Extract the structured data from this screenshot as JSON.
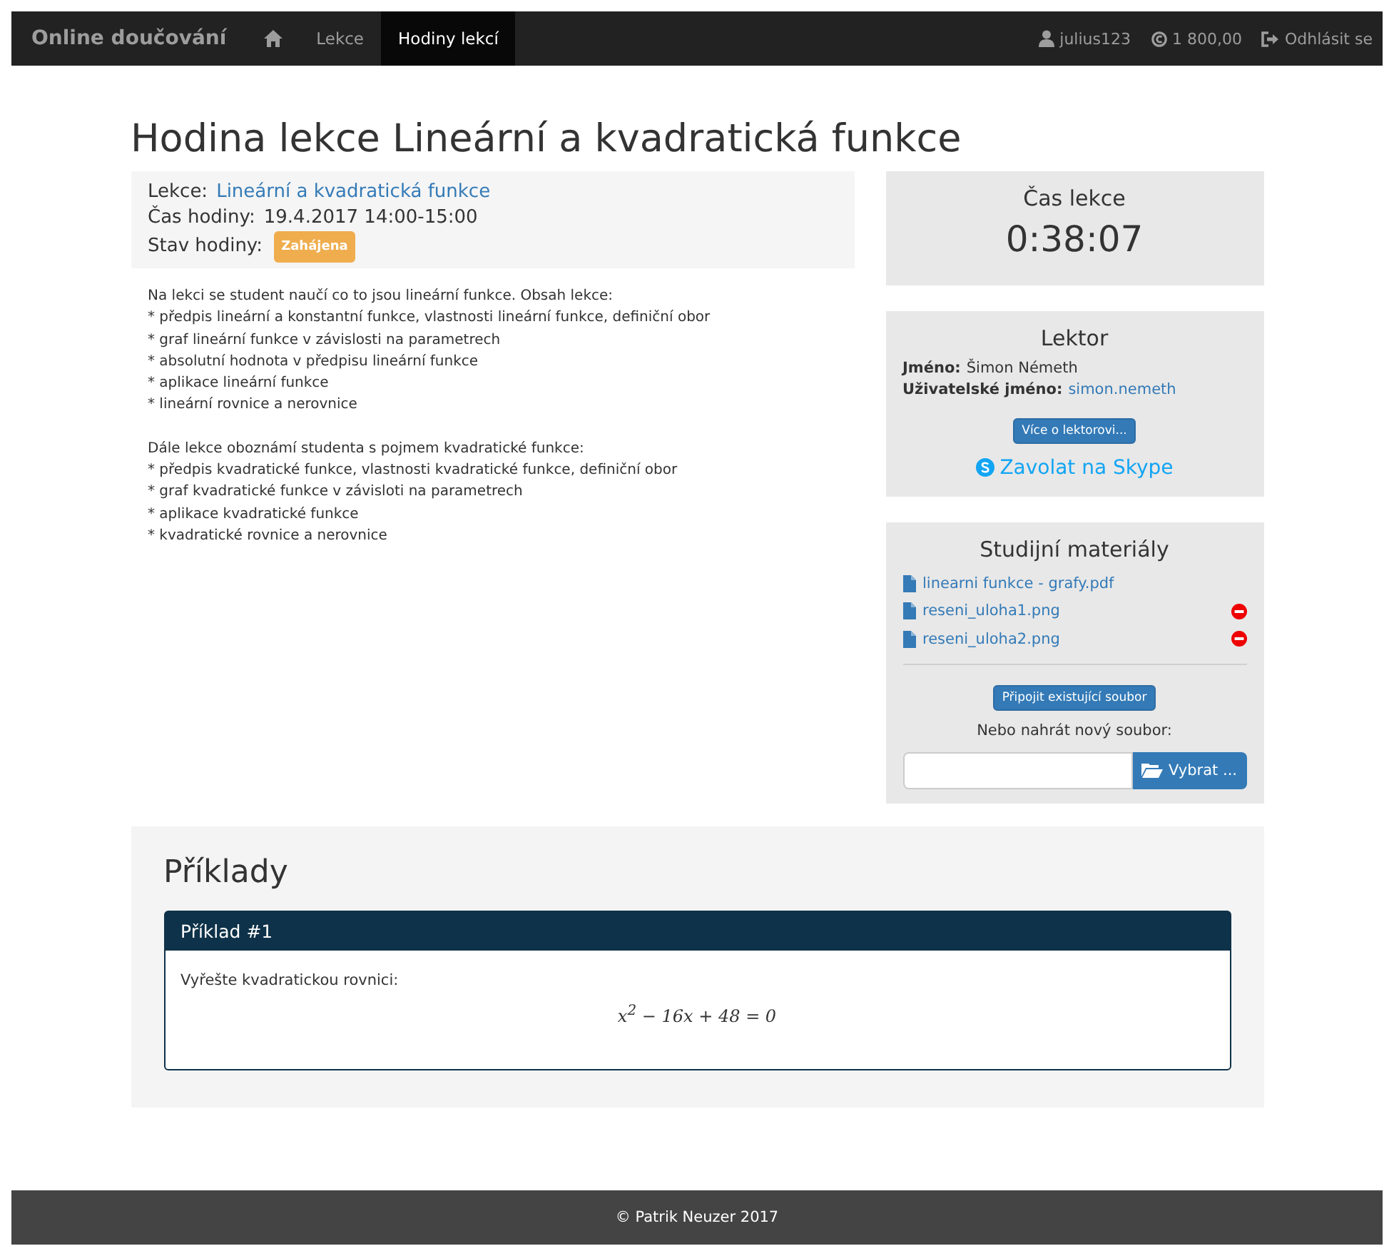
{
  "navbar": {
    "brand": "Online doučování",
    "items": [
      {
        "kind": "home",
        "selected": false
      },
      {
        "kind": "link",
        "label": "Lekce",
        "selected": false
      },
      {
        "kind": "link",
        "label": "Hodiny lekcí",
        "selected": true
      }
    ],
    "user": "julius123",
    "credit": "1 800,00",
    "logout": "Odhlásit se"
  },
  "title": "Hodina lekce Lineární a kvadratická funkce",
  "info": [
    {
      "label": "Lekce:",
      "kind": "link",
      "value": "Lineární a kvadratická funkce"
    },
    {
      "label": "Čas hodiny:",
      "kind": "text",
      "value": "19.4.2017 14:00-15:00"
    },
    {
      "label": "Stav hodiny:",
      "kind": "badge",
      "value": "Zahájena"
    }
  ],
  "description": [
    [
      "Na lekci se student naučí co to jsou lineární funkce. Obsah lekce:",
      "* předpis lineární a konstantní funkce, vlastnosti lineární funkce, definiční obor",
      "* graf lineární funkce v závislosti na parametrech",
      "* absolutní hodnota v předpisu lineární funkce",
      "* aplikace lineární funkce",
      "* lineární rovnice a nerovnice"
    ],
    [
      "Dále lekce oboznámí studenta s pojmem kvadratické funkce:",
      "* předpis kvadratické funkce, vlastnosti kvadratické funkce, definiční obor",
      "* graf kvadratické funkce v závisloti na parametrech",
      "* aplikace kvadratické funkce",
      "* kvadratické rovnice a nerovnice"
    ]
  ],
  "timer": {
    "title": "Čas lekce",
    "value": "0:38:07"
  },
  "tutor": {
    "title": "Lektor",
    "name_label": "Jméno:",
    "name": "Šimon Németh",
    "username_label": "Uživatelské jméno:",
    "username": "simon.nemeth",
    "more_button": "Více o lektorovi...",
    "skype": "Zavolat na Skype"
  },
  "materials": {
    "title": "Studijní materiály",
    "files": [
      {
        "name": "linearni funkce - grafy.pdf",
        "removable": false
      },
      {
        "name": "reseni_uloha1.png",
        "removable": true
      },
      {
        "name": "reseni_uloha2.png",
        "removable": true
      }
    ],
    "attach_button": "Připojit existující soubor",
    "upload_label": "Nebo nahrát nový soubor:",
    "browse_button": "Vybrat ..."
  },
  "examples": {
    "title": "Příklady",
    "items": [
      {
        "title": "Příklad #1",
        "text": "Vyřešte kvadratickou rovnici:",
        "equation": "x$^{2}$ − 16x + 48 = 0"
      }
    ]
  },
  "footer": "© Patrik Neuzer 2017"
}
